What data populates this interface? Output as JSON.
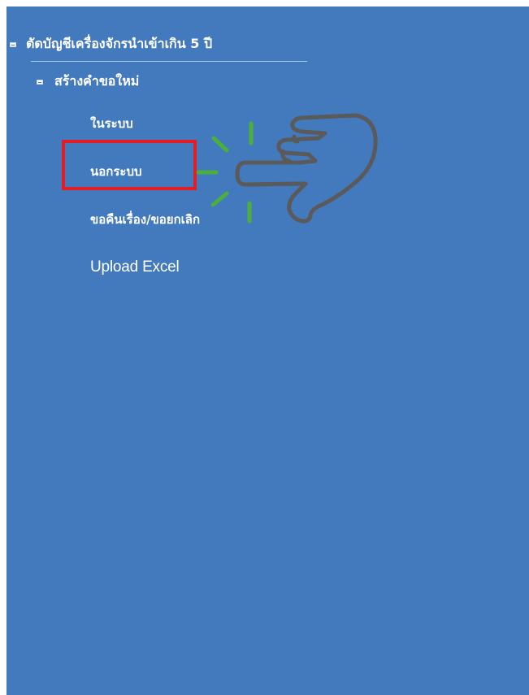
{
  "menu": {
    "group_title": "ตัดบัญชีเครื่องจักรนำเข้าเกิน 5 ปี",
    "sub_group_title": "สร้างคำขอใหม่",
    "items": [
      {
        "label": "ในระบบ"
      },
      {
        "label": "นอกระบบ"
      },
      {
        "label": "ขอคืนเรื่อง/ขอยกเลิก"
      },
      {
        "label": "Upload Excel"
      }
    ]
  },
  "annotation": {
    "highlighted_item": "นอกระบบ",
    "highlight_color": "#e51c23",
    "pointer_icon": "pointing-hand-icon",
    "click_effect_color": "#4caf3c"
  },
  "colors": {
    "panel_background": "#4379bd",
    "text": "#ffffff"
  }
}
